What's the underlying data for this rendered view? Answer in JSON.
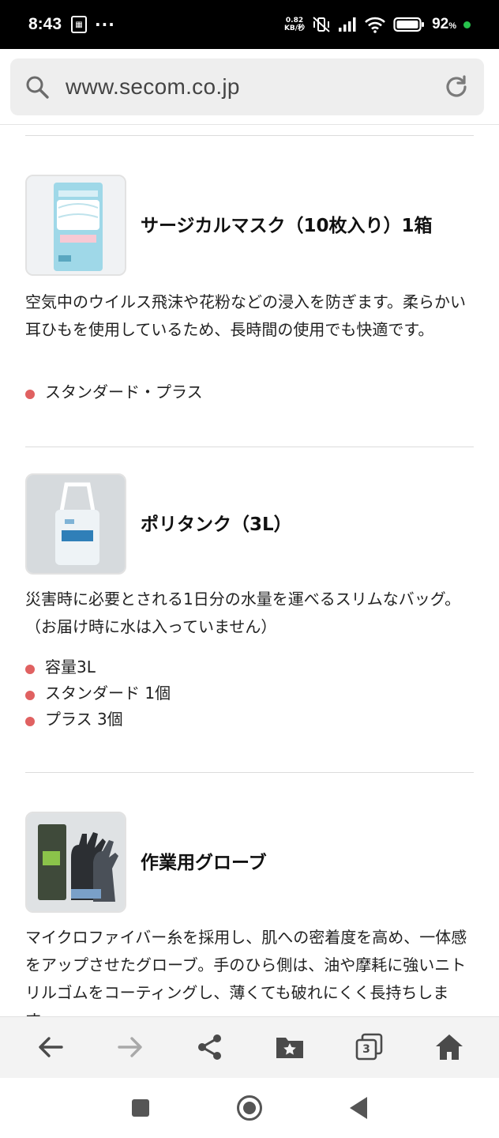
{
  "status_bar": {
    "time": "8:43",
    "more": "···",
    "net_speed_value": "0.82",
    "net_speed_unit": "KB/秒",
    "battery_percent": "92",
    "battery_unit": "%"
  },
  "browser": {
    "url": "www.secom.co.jp"
  },
  "products": [
    {
      "title": "サージカルマスク（10枚入り）1箱",
      "description": "空気中のウイルス飛沫や花粉などの浸入を防ぎます。柔らかい耳ひもを使用しているため、長時間の使用でも快適です。",
      "features": [
        "スタンダード・プラス"
      ]
    },
    {
      "title": "ポリタンク（3L）",
      "description": "災害時に必要とされる1日分の水量を運べるスリムなバッグ。（お届け時に水は入っていません）",
      "features": [
        "容量3L",
        "スタンダード 1個",
        "プラス 3個"
      ]
    },
    {
      "title": "作業用グローブ",
      "description": "マイクロファイバー糸を採用し、肌への密着度を高め、一体感をアップさせたグローブ。手のひら側は、油や摩耗に強いニトリルゴムをコーティングし、薄くても破れにくく長持ちします。",
      "features": []
    }
  ],
  "toolbar": {
    "tabs_count": "3"
  },
  "colors": {
    "bullet": "#e06161",
    "status_bar_bg": "#000000",
    "url_bar_bg": "#eeeeee",
    "toolbar_bg": "#f3f3f3"
  },
  "icons": [
    "search-icon",
    "reload-icon",
    "back-icon",
    "forward-icon",
    "share-icon",
    "bookmarks-icon",
    "tabs-icon",
    "home-icon",
    "recent-apps-icon",
    "nav-home-icon",
    "nav-back-icon"
  ]
}
